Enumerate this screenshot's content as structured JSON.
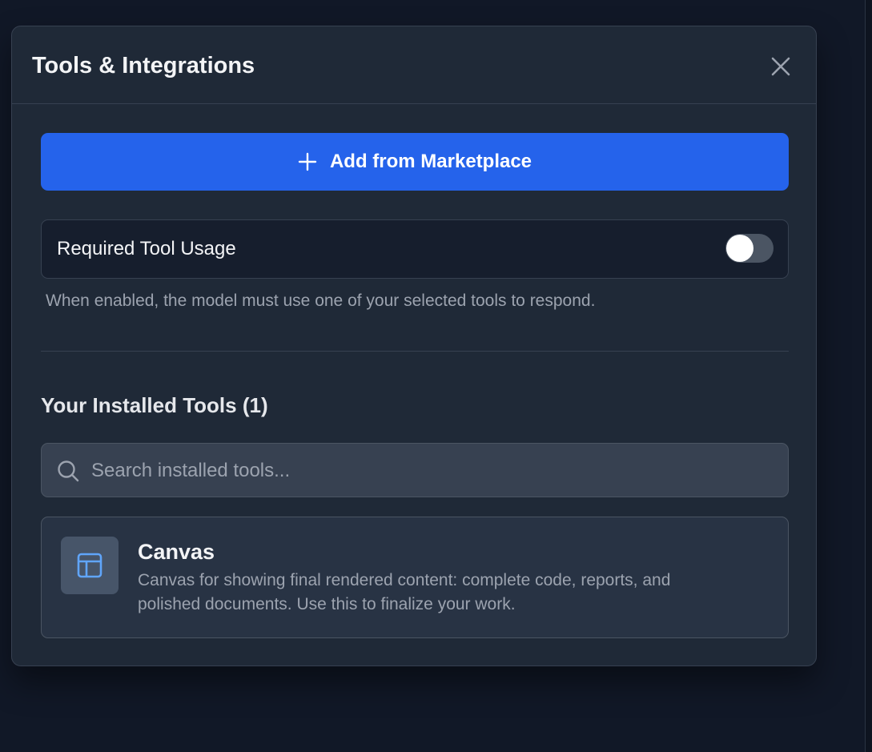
{
  "dialog": {
    "title": "Tools & Integrations",
    "close_icon": "close-icon"
  },
  "marketplace_button": {
    "icon": "plus-icon",
    "label": "Add from Marketplace"
  },
  "required_tool_usage": {
    "label": "Required Tool Usage",
    "enabled": false,
    "help_text": "When enabled, the model must use one of your selected tools to respond."
  },
  "installed_tools": {
    "heading": "Your Installed Tools (1)",
    "search": {
      "icon": "search-icon",
      "placeholder": "Search installed tools...",
      "value": ""
    },
    "items": [
      {
        "icon": "layout-panel-icon",
        "name": "Canvas",
        "description": "Canvas for showing final rendered content: complete code, reports, and polished documents. Use this to finalize your work."
      }
    ]
  },
  "colors": {
    "accent": "#2563eb",
    "background": "#111827",
    "panel": "#1f2937",
    "icon_accent": "#60a5fa"
  }
}
